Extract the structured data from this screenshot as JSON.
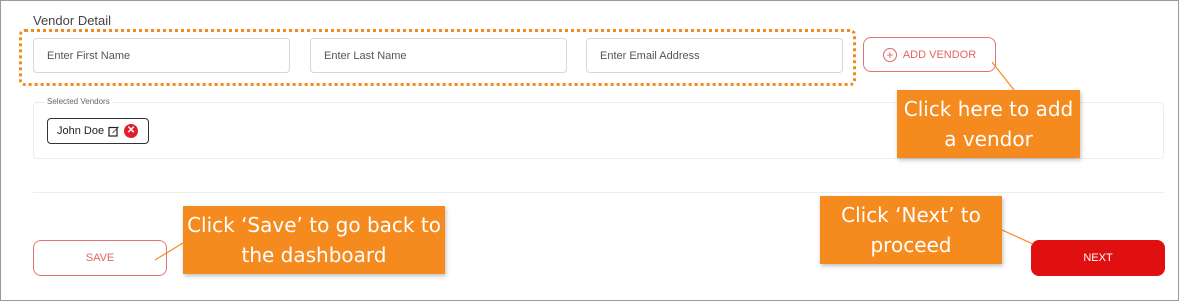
{
  "vendor_form": {
    "section_title": "Vendor Detail",
    "first_name_placeholder": "Enter First Name",
    "last_name_placeholder": "Enter Last Name",
    "email_placeholder": "Enter Email Address",
    "add_vendor_label": "ADD VENDOR",
    "add_icon": "plus-circle-icon"
  },
  "selected_vendors": {
    "legend": "Selected Vendors",
    "items": [
      {
        "name": "John Doe",
        "edit_icon": "edit-icon",
        "remove_icon": "remove-icon"
      }
    ]
  },
  "actions": {
    "save_label": "SAVE",
    "next_label": "NEXT"
  },
  "callouts": {
    "add_vendor": "Click here to add a vendor",
    "save": "Click ‘Save’ to go back to the dashboard",
    "next": "Click ‘Next’ to proceed"
  },
  "colors": {
    "accent_red": "#e01010",
    "callout_orange": "#f58a1f",
    "outline_red": "#e57373"
  }
}
